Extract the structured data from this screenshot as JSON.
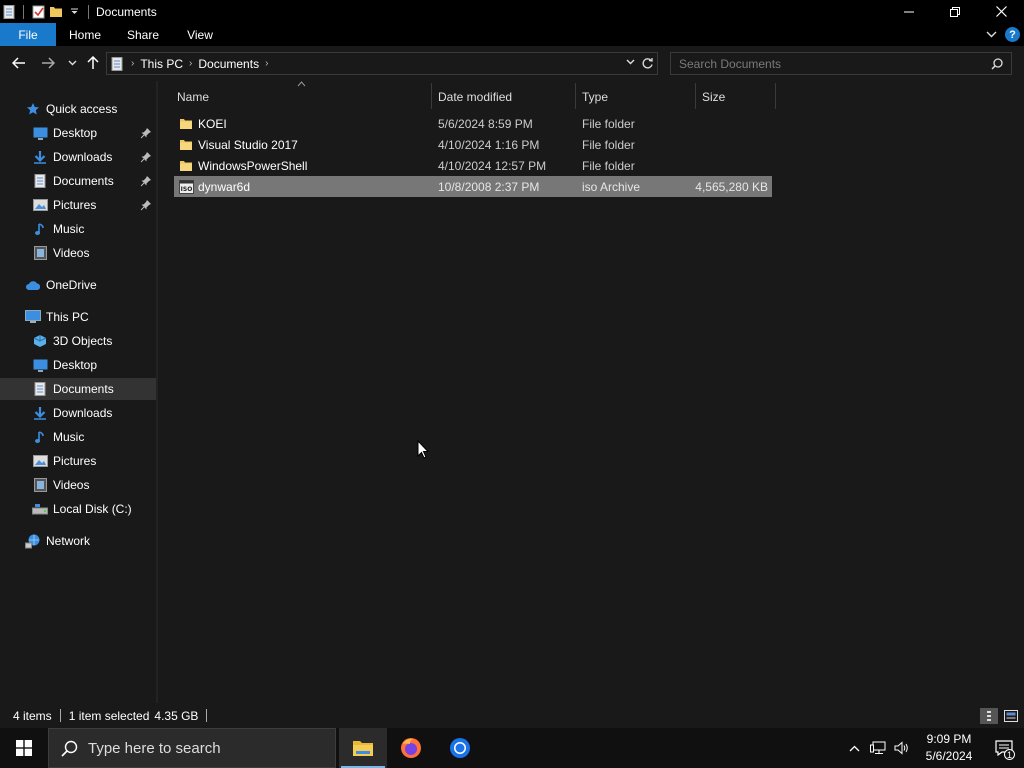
{
  "window": {
    "title": "Documents"
  },
  "ribbon": {
    "tabs": [
      "File",
      "Home",
      "Share",
      "View"
    ]
  },
  "address": {
    "crumbs": [
      "This PC",
      "Documents"
    ]
  },
  "search": {
    "placeholder": "Search Documents"
  },
  "nav": {
    "quick_access": "Quick access",
    "quick_items": [
      {
        "label": "Desktop",
        "icon": "desktop-icon",
        "pinned": true
      },
      {
        "label": "Downloads",
        "icon": "downloads-icon",
        "pinned": true
      },
      {
        "label": "Documents",
        "icon": "documents-icon",
        "pinned": true
      },
      {
        "label": "Pictures",
        "icon": "pictures-icon",
        "pinned": true
      },
      {
        "label": "Music",
        "icon": "music-icon",
        "pinned": false
      },
      {
        "label": "Videos",
        "icon": "videos-icon",
        "pinned": false
      }
    ],
    "onedrive": "OneDrive",
    "this_pc": "This PC",
    "pc_items": [
      {
        "label": "3D Objects",
        "icon": "3d-objects-icon"
      },
      {
        "label": "Desktop",
        "icon": "desktop-icon"
      },
      {
        "label": "Documents",
        "icon": "documents-icon",
        "selected": true
      },
      {
        "label": "Downloads",
        "icon": "downloads-icon"
      },
      {
        "label": "Music",
        "icon": "music-icon"
      },
      {
        "label": "Pictures",
        "icon": "pictures-icon"
      },
      {
        "label": "Videos",
        "icon": "videos-icon"
      },
      {
        "label": "Local Disk (C:)",
        "icon": "local-disk-icon"
      }
    ],
    "network": "Network"
  },
  "columns": {
    "name": "Name",
    "date": "Date modified",
    "type": "Type",
    "size": "Size"
  },
  "files": [
    {
      "name": "KOEI",
      "date": "5/6/2024 8:59 PM",
      "type": "File folder",
      "size": "",
      "icon": "folder-icon"
    },
    {
      "name": "Visual Studio 2017",
      "date": "4/10/2024 1:16 PM",
      "type": "File folder",
      "size": "",
      "icon": "folder-icon"
    },
    {
      "name": "WindowsPowerShell",
      "date": "4/10/2024 12:57 PM",
      "type": "File folder",
      "size": "",
      "icon": "folder-icon"
    },
    {
      "name": "dynwar6d",
      "date": "10/8/2008 2:37 PM",
      "type": "iso Archive",
      "size": "4,565,280 KB",
      "icon": "iso-file-icon",
      "selected": true
    }
  ],
  "status": {
    "count": "4 items",
    "selection": "1 item selected",
    "selection_size": "4.35 GB"
  },
  "taskbar": {
    "search_placeholder": "Type here to search",
    "time": "9:09 PM",
    "date": "5/6/2024",
    "notification_count": "1"
  },
  "colors": {
    "accent": "#1979ca",
    "background": "#191919",
    "selection": "#777777",
    "folder": "#f0c75e"
  }
}
